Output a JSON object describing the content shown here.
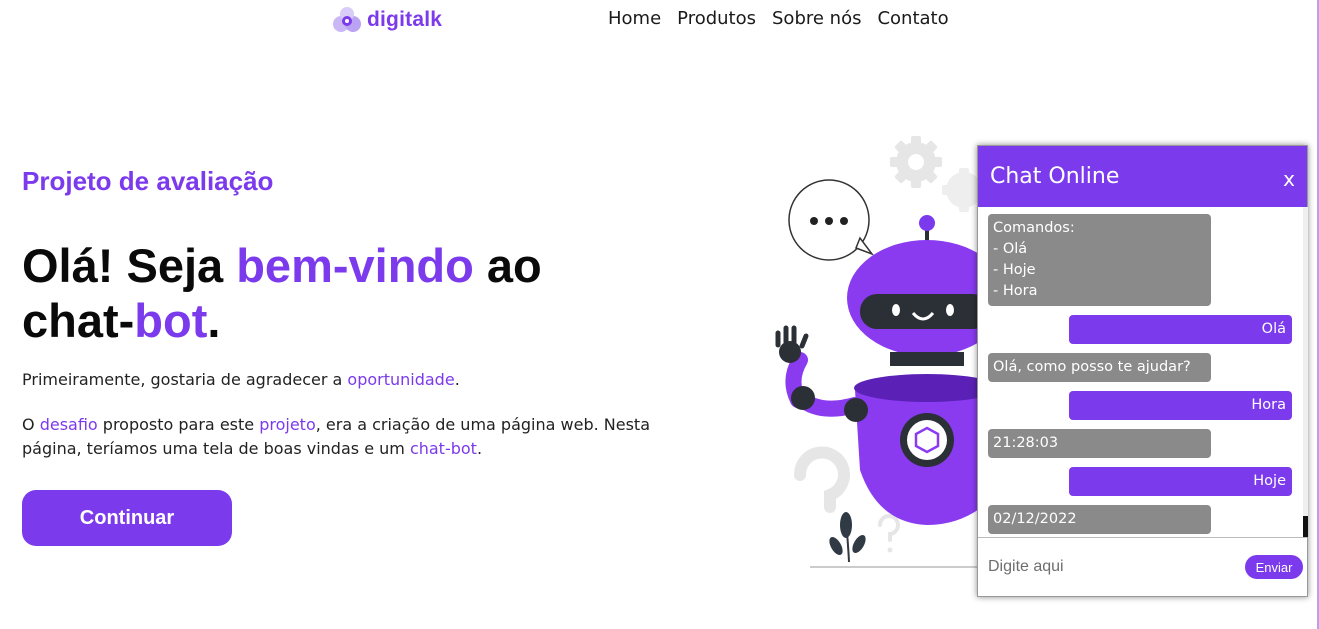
{
  "brand": {
    "name": "digitalk",
    "accent_color": "#7c3aed"
  },
  "nav": {
    "items": [
      "Home",
      "Produtos",
      "Sobre nós",
      "Contato"
    ]
  },
  "hero": {
    "eyebrow": "Projeto de avaliação",
    "headline": {
      "part1": "Olá! Seja ",
      "accent1": "bem-vindo",
      "part2": " ao chat-",
      "accent2": "bot",
      "part3": "."
    },
    "para1": {
      "text": "Primeiramente, gostaria de agradecer a ",
      "link": "oportunidade",
      "end": "."
    },
    "para2": {
      "t1": "O ",
      "l1": "desafio",
      "t2": " proposto para este ",
      "l2": "projeto",
      "t3": ", era a criação de uma página web. Nesta página, teríamos uma tela de boas vindas e um ",
      "l3": "chat-bot",
      "t4": "."
    },
    "cta_label": "Continuar"
  },
  "illustration": {
    "icon": "robot-waving-icon",
    "bubble_text": "• • •"
  },
  "chat": {
    "title": "Chat Online",
    "close_label": "x",
    "commands_lines": [
      "Comandos:",
      "- Olá",
      "- Hoje",
      "- Hora"
    ],
    "messages": [
      {
        "from": "user",
        "text": "Olá"
      },
      {
        "from": "bot",
        "text": "Olá, como posso te ajudar?"
      },
      {
        "from": "user",
        "text": "Hora"
      },
      {
        "from": "bot",
        "text": "21:28:03"
      },
      {
        "from": "user",
        "text": "Hoje"
      },
      {
        "from": "bot",
        "text": "02/12/2022"
      }
    ],
    "input_placeholder": "Digite aqui",
    "send_label": "Enviar"
  }
}
